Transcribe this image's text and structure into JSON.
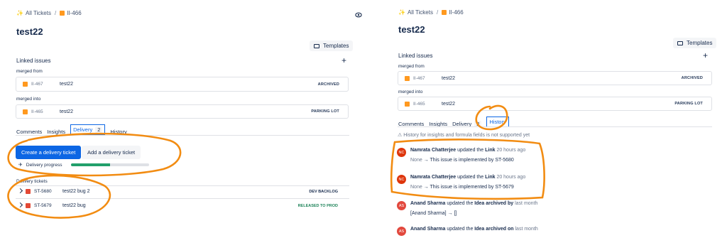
{
  "colors": {
    "primary": "#0c66e4",
    "annotation": "#f28c12",
    "progress": "#22a06b",
    "released": "#1f845a",
    "dev_backlog": "#172b4d"
  },
  "left": {
    "breadcrumb": {
      "all": "All Tickets",
      "sep": "/",
      "key": "II-466"
    },
    "title": "test22",
    "templates_label": "Templates",
    "linked_issues": "Linked issues",
    "plus": "+",
    "merged_from": "merged from",
    "merged_into": "merged into",
    "links": [
      {
        "key": "II-467",
        "summary": "test22",
        "status": "ARCHIVED"
      },
      {
        "key": "II-465",
        "summary": "test22",
        "status": "PARKING LOT"
      }
    ],
    "tabs": [
      {
        "label": "Comments"
      },
      {
        "label": "Insights"
      },
      {
        "label": "Delivery",
        "count": "2"
      },
      {
        "label": "History"
      }
    ],
    "create_btn": "Create a delivery ticket",
    "add_btn": "Add a delivery ticket",
    "progress_label": "Delivery progress",
    "progress_value": 0.5,
    "delivery_tickets_label": "Delivery tickets",
    "delivery_tickets": [
      {
        "key": "ST-5680",
        "summary": "test22 bug 2",
        "status": "DEV BACKLOG"
      },
      {
        "key": "ST-5679",
        "summary": "test22 bug",
        "status": "RELEASED TO PROD"
      }
    ]
  },
  "right": {
    "breadcrumb": {
      "all": "All Tickets",
      "sep": "/",
      "key": "II-466"
    },
    "title": "test22",
    "templates_label": "Templates",
    "linked_issues": "Linked issues",
    "plus": "+",
    "merged_from": "merged from",
    "merged_into": "merged into",
    "links": [
      {
        "key": "II-467",
        "summary": "test22",
        "status": "ARCHIVED"
      },
      {
        "key": "II-465",
        "summary": "test22",
        "status": "PARKING LOT"
      }
    ],
    "tabs": [
      {
        "label": "Comments"
      },
      {
        "label": "Insights"
      },
      {
        "label": "Delivery",
        "count": "2"
      },
      {
        "label": "History"
      }
    ],
    "history_note": "History for insights and formula fields is not supported yet",
    "history": [
      {
        "initials": "NC",
        "name": "Namrata Chatterjee",
        "action": "updated the",
        "field": "Link",
        "time": "20 hours ago",
        "from": "None",
        "arrow": "→",
        "to": "This issue is implemented by ST-5680",
        "color": "#de350b"
      },
      {
        "initials": "NC",
        "name": "Namrata Chatterjee",
        "action": "updated the",
        "field": "Link",
        "time": "20 hours ago",
        "from": "None",
        "arrow": "→",
        "to": "This issue is implemented by ST-5679",
        "color": "#de350b"
      },
      {
        "initials": "AS",
        "name": "Anand Sharma",
        "action": "updated the",
        "field": "Idea archived by",
        "time": "last month",
        "from": "[Anand Sharma]",
        "arrow": "→",
        "to": "[]",
        "color": "#e2483d"
      },
      {
        "initials": "AS",
        "name": "Anand Sharma",
        "action": "updated the",
        "field": "Idea archived on",
        "time": "last month",
        "from": "",
        "arrow": "",
        "to": "",
        "color": "#e2483d"
      }
    ]
  }
}
